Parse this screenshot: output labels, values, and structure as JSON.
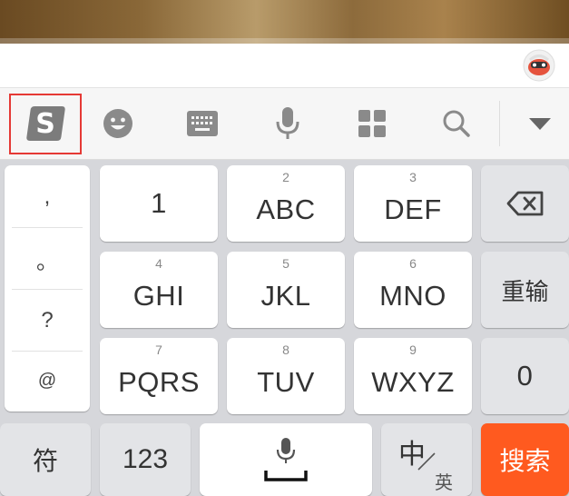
{
  "toolbar": {
    "icons": [
      "sogou-logo-icon",
      "emoji-icon",
      "keyboard-icon",
      "microphone-icon",
      "grid-icon",
      "search-icon",
      "collapse-arrow-icon"
    ]
  },
  "punctuation": [
    ",",
    "。",
    "?",
    "@"
  ],
  "keys": {
    "row1": [
      {
        "number": "",
        "label": "1"
      },
      {
        "number": "2",
        "label": "ABC"
      },
      {
        "number": "3",
        "label": "DEF"
      }
    ],
    "row2": [
      {
        "number": "4",
        "label": "GHI"
      },
      {
        "number": "5",
        "label": "JKL"
      },
      {
        "number": "6",
        "label": "MNO"
      }
    ],
    "row3": [
      {
        "number": "7",
        "label": "PQRS"
      },
      {
        "number": "8",
        "label": "TUV"
      },
      {
        "number": "9",
        "label": "WXYZ"
      }
    ],
    "reinput": "重输",
    "zero": "0",
    "symbols": "符",
    "numbers": "123",
    "lang_main": "中",
    "lang_sub": "英",
    "search": "搜索"
  },
  "colors": {
    "accent": "#ff5a1f",
    "highlight": "#e53935",
    "sogou": "#8a8a8a"
  }
}
